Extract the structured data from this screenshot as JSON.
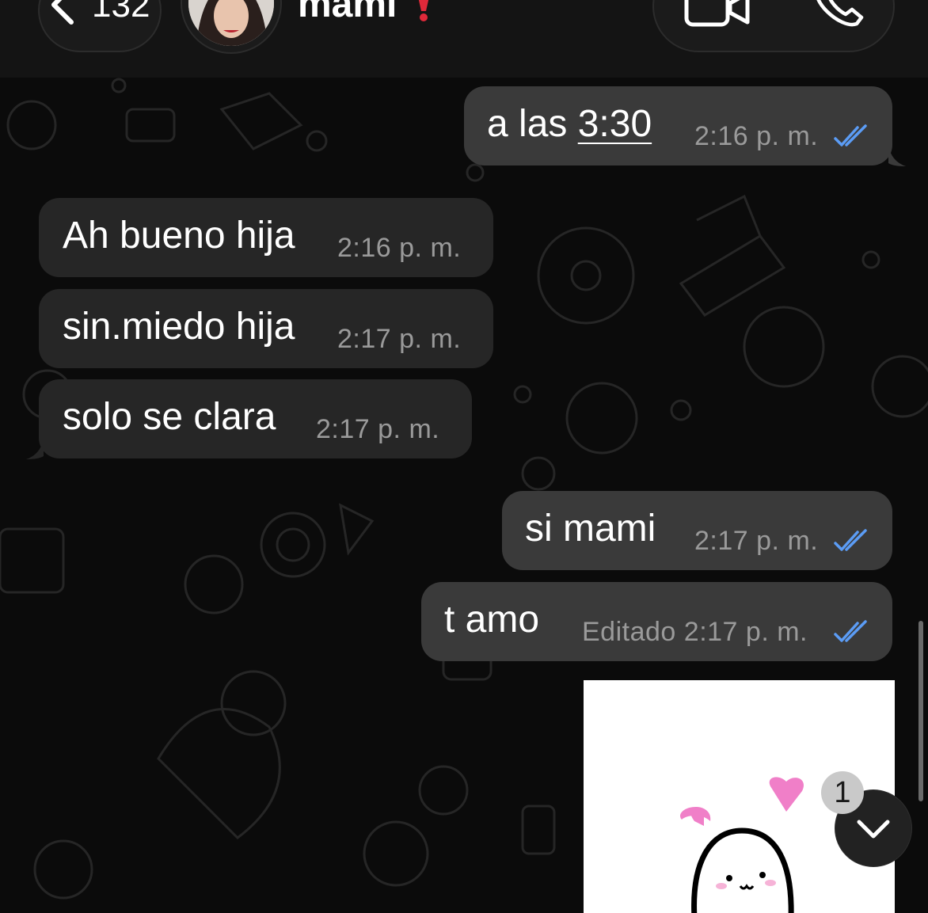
{
  "header": {
    "back_count": "132",
    "contact_name": "mami",
    "status_emoji_icon": "exclamation-icon",
    "accent": "#e0293a"
  },
  "messages": [
    {
      "direction": "out",
      "text_prefix": "a las ",
      "text_link": "3:30",
      "time": "2:16",
      "ampm": "p. m.",
      "read": true
    },
    {
      "direction": "in",
      "text": "Ah bueno hija",
      "time": "2:16",
      "ampm": "p. m."
    },
    {
      "direction": "in",
      "text": "sin.miedo hija",
      "time": "2:17",
      "ampm": "p. m."
    },
    {
      "direction": "in",
      "text": "solo se clara",
      "time": "2:17",
      "ampm": "p. m."
    },
    {
      "direction": "out",
      "text": "si mami",
      "time": "2:17",
      "ampm": "p. m.",
      "read": true
    },
    {
      "direction": "out",
      "text": "t amo",
      "edited_label": "Editado",
      "time": "2:17",
      "ampm": "p. m.",
      "read": true
    }
  ],
  "unread_badge": "1",
  "colors": {
    "incoming_bubble": "#262626",
    "outgoing_bubble": "#3a3a3a",
    "read_ticks": "#5b9cf5",
    "sticker_hearts": "#f07fc8"
  }
}
